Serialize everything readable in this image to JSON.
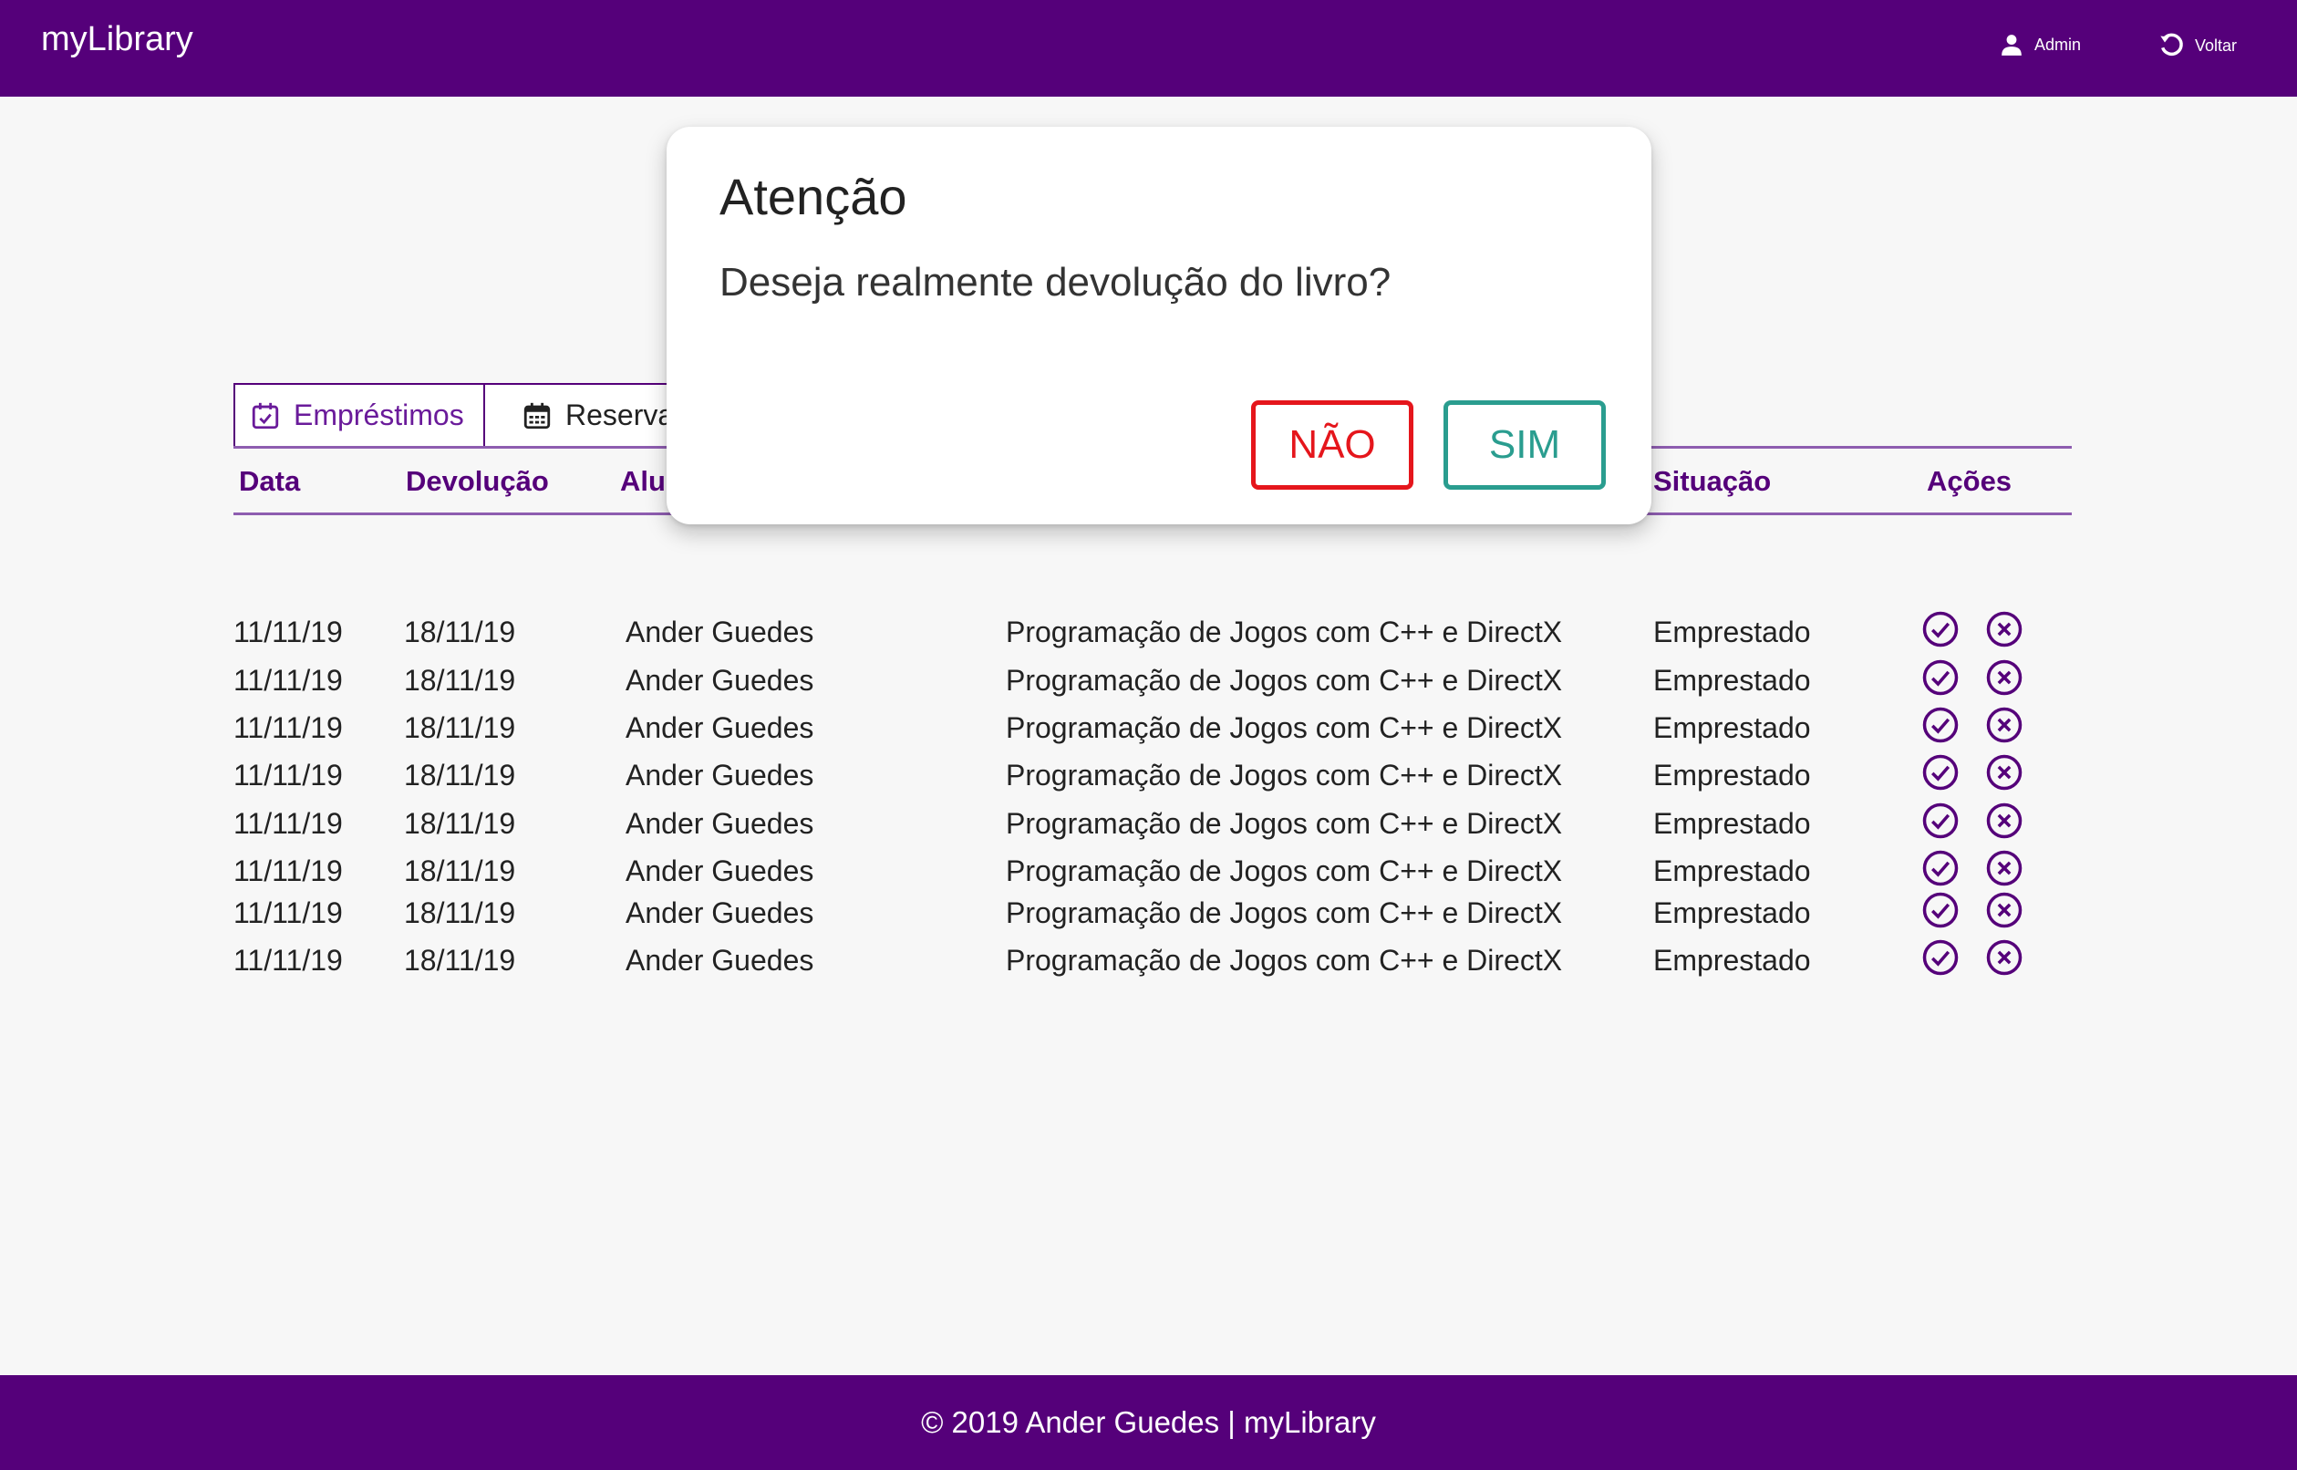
{
  "header": {
    "brand": "myLibrary",
    "user_label": "Admin",
    "back_label": "Voltar"
  },
  "tabs": [
    {
      "label": "Empréstimos",
      "icon": "calendar-check-icon",
      "active": true
    },
    {
      "label": "Reserva",
      "icon": "calendar-icon",
      "active": false
    }
  ],
  "table": {
    "headers": {
      "data": "Data",
      "devolucao": "Devolução",
      "aluno": "Alu",
      "situacao": "Situação",
      "acoes": "Ações"
    },
    "rows": [
      {
        "data": "11/11/19",
        "devolucao": "18/11/19",
        "aluno": "Ander Guedes",
        "livro": "Programação de Jogos com C++ e DirectX",
        "situacao": "Emprestado"
      },
      {
        "data": "11/11/19",
        "devolucao": "18/11/19",
        "aluno": "Ander Guedes",
        "livro": "Programação de Jogos com C++ e DirectX",
        "situacao": "Emprestado"
      },
      {
        "data": "11/11/19",
        "devolucao": "18/11/19",
        "aluno": "Ander Guedes",
        "livro": "Programação de Jogos com C++ e DirectX",
        "situacao": "Emprestado"
      },
      {
        "data": "11/11/19",
        "devolucao": "18/11/19",
        "aluno": "Ander Guedes",
        "livro": "Programação de Jogos com C++ e DirectX",
        "situacao": "Emprestado"
      },
      {
        "data": "11/11/19",
        "devolucao": "18/11/19",
        "aluno": "Ander Guedes",
        "livro": "Programação de Jogos com C++ e DirectX",
        "situacao": "Emprestado"
      },
      {
        "data": "11/11/19",
        "devolucao": "18/11/19",
        "aluno": "Ander Guedes",
        "livro": "Programação de Jogos com C++ e DirectX",
        "situacao": "Emprestado"
      },
      {
        "data": "11/11/19",
        "devolucao": "18/11/19",
        "aluno": "Ander Guedes",
        "livro": "Programação de Jogos com C++ e DirectX",
        "situacao": "Emprestado"
      },
      {
        "data": "11/11/19",
        "devolucao": "18/11/19",
        "aluno": "Ander Guedes",
        "livro": "Programação de Jogos com C++ e DirectX",
        "situacao": "Emprestado"
      }
    ],
    "action_icons": [
      "check-circle-icon",
      "close-circle-icon"
    ]
  },
  "modal": {
    "title": "Atenção",
    "message": "Deseja realmente devolução do livro?",
    "no_label": "NÃO",
    "yes_label": "SIM"
  },
  "footer": {
    "text": "© 2019 Ander Guedes | myLibrary"
  },
  "colors": {
    "primary": "#55007a",
    "danger": "#e5161c",
    "confirm": "#2a9d8f"
  }
}
